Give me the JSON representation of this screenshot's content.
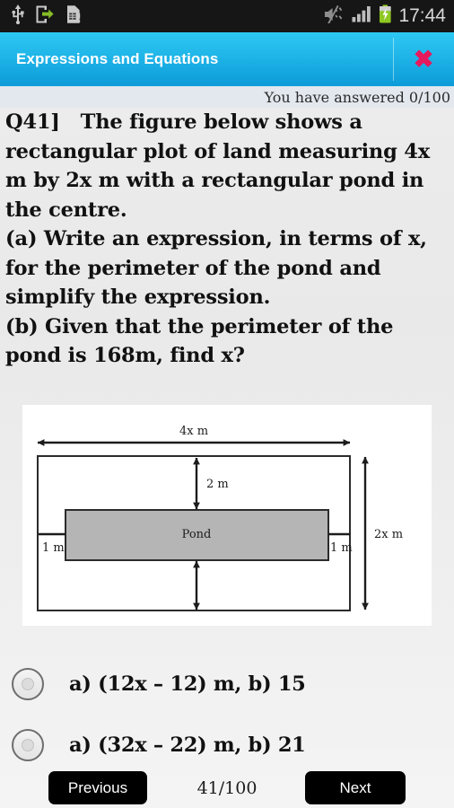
{
  "status_bar": {
    "icons": [
      "usb-icon",
      "usb-debugging-icon",
      "sim-card-alert-icon"
    ],
    "right_icons": [
      "sound-muted-icon",
      "signal-bars-icon",
      "battery-charging-icon"
    ],
    "time": "17:44"
  },
  "title_bar": {
    "title": "Expressions and Equations",
    "close_label": "✖",
    "accent_color": "#1fb5e8",
    "close_color": "#e8185c"
  },
  "progress": {
    "answered_text": "You have answered 0/100"
  },
  "question": {
    "text": "Q41]   The figure below shows a rectangular plot of land measuring 4x m by 2x m with a rectangular pond in the centre.\n(a) Write an expression, in terms of x, for the perimeter of the pond and simplify the expression.\n(b) Given that the perimeter of the pond is 168m, find x?"
  },
  "figure": {
    "outer_label_top": "4x m",
    "outer_label_right": "2x m",
    "gap_top_label": "2 m",
    "gap_left_label": "1 m",
    "gap_right_label": "1 m",
    "pond_label": "Pond",
    "pond_fill": "#b5b5b5",
    "stroke_color": "#2b2b2b",
    "background": "#ffffff"
  },
  "options": [
    {
      "label": "a) (12x – 12) m, b) 15",
      "selected": false
    },
    {
      "label": "a) (32x – 22) m, b) 21",
      "selected": false
    }
  ],
  "bottom_nav": {
    "previous_label": "Previous",
    "next_label": "Next",
    "counter": "41/100"
  }
}
